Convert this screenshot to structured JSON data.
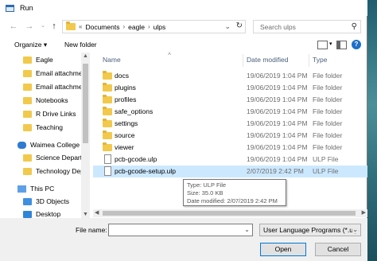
{
  "window": {
    "title": "Run"
  },
  "address_bar": {
    "prefix": "«",
    "crumbs": [
      "Documents",
      "eagle",
      "ulps"
    ]
  },
  "search": {
    "placeholder": "Search ulps"
  },
  "toolbar": {
    "organize_label": "Organize ▾",
    "new_folder_label": "New folder"
  },
  "nav_pane": {
    "items": [
      {
        "label": "Eagle",
        "icon": "folder-icon"
      },
      {
        "label": "Email attachmen",
        "icon": "folder-icon"
      },
      {
        "label": "Email attachmen",
        "icon": "folder-icon"
      },
      {
        "label": "Notebooks",
        "icon": "folder-icon"
      },
      {
        "label": "R Drive Links",
        "icon": "folder-icon"
      },
      {
        "label": "Teaching",
        "icon": "folder-icon"
      },
      {
        "label": "Waimea College",
        "icon": "onedrive-icon"
      },
      {
        "label": "Science Departm",
        "icon": "folder-icon"
      },
      {
        "label": "Technology Dep",
        "icon": "folder-icon"
      },
      {
        "label": "This PC",
        "icon": "computer-icon"
      },
      {
        "label": "3D Objects",
        "icon": "cube-icon"
      },
      {
        "label": "Desktop",
        "icon": "desktop-icon"
      }
    ]
  },
  "columns": {
    "name": "Name",
    "date": "Date modified",
    "type": "Type"
  },
  "files": [
    {
      "name": "docs",
      "date": "19/06/2019 1:04 PM",
      "type": "File folder",
      "icon": "folder-icon"
    },
    {
      "name": "plugins",
      "date": "19/06/2019 1:04 PM",
      "type": "File folder",
      "icon": "folder-icon"
    },
    {
      "name": "profiles",
      "date": "19/06/2019 1:04 PM",
      "type": "File folder",
      "icon": "folder-icon"
    },
    {
      "name": "safe_options",
      "date": "19/06/2019 1:04 PM",
      "type": "File folder",
      "icon": "folder-icon"
    },
    {
      "name": "settings",
      "date": "19/06/2019 1:04 PM",
      "type": "File folder",
      "icon": "folder-icon"
    },
    {
      "name": "source",
      "date": "19/06/2019 1:04 PM",
      "type": "File folder",
      "icon": "folder-icon"
    },
    {
      "name": "viewer",
      "date": "19/06/2019 1:04 PM",
      "type": "File folder",
      "icon": "folder-icon"
    },
    {
      "name": "pcb-gcode.ulp",
      "date": "19/06/2019 1:04 PM",
      "type": "ULP File",
      "icon": "file-icon"
    },
    {
      "name": "pcb-gcode-setup.ulp",
      "date": "2/07/2019 2:42 PM",
      "type": "ULP File",
      "icon": "file-icon",
      "selected": true
    }
  ],
  "tooltip": {
    "type": "Type: ULP File",
    "size": "Size: 35.0 KB",
    "date": "Date modified: 2/07/2019 2:42 PM"
  },
  "footer": {
    "file_name_label": "File name:",
    "file_name_value": "",
    "file_type": "User Language Programs (*.ulp",
    "open_label": "Open",
    "cancel_label": "Cancel"
  },
  "colors": {
    "selection": "#cce8ff",
    "folder": "#f2c94c",
    "accent": "#0078d7"
  }
}
